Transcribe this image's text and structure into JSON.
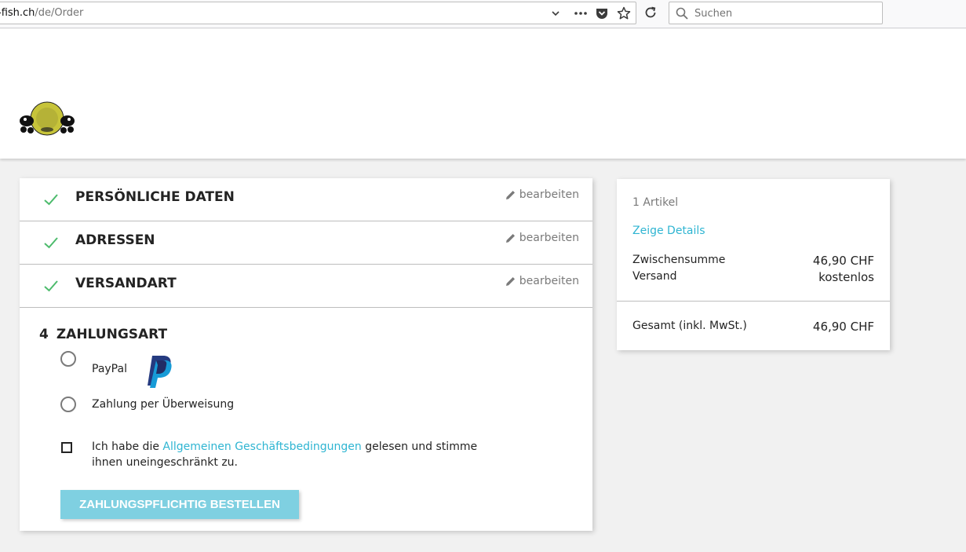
{
  "browser": {
    "url_domain": "-fish.ch",
    "url_path": "/de/Order",
    "search_placeholder": "Suchen"
  },
  "checkout": {
    "edit_label": "bearbeiten",
    "steps": [
      {
        "title": "Persönliche Daten"
      },
      {
        "title": "Adressen"
      },
      {
        "title": "Versandart"
      }
    ],
    "payment": {
      "number": "4",
      "title": "Zahlungsart",
      "options": [
        {
          "label": "PayPal"
        },
        {
          "label": "Zahlung per Überweisung"
        }
      ],
      "terms_before": "Ich habe die ",
      "terms_link": "Allgemeinen Geschäftsbedingungen",
      "terms_after": " gelesen und stimme ihnen uneingeschränkt zu.",
      "order_button": "Zahlungspflichtig bestellen"
    }
  },
  "summary": {
    "item_count": "1 Artikel",
    "details_link": "Zeige Details",
    "subtotal_label": "Zwischensumme",
    "subtotal_value": "46,90 CHF",
    "shipping_label": "Versand",
    "shipping_value": "kostenlos",
    "total_label": "Gesamt (inkl. MwSt.)",
    "total_value": "46,90 CHF"
  },
  "colors": {
    "accent": "#2fb5d2",
    "check": "#4cbb6c",
    "button": "#7fd0e1"
  },
  "icons": [
    "chevron-down-icon",
    "more-icon",
    "pocket-icon",
    "bookmark-star-icon",
    "reload-icon",
    "search-icon",
    "check-icon",
    "pencil-icon",
    "paypal-logo",
    "shop-logo"
  ]
}
